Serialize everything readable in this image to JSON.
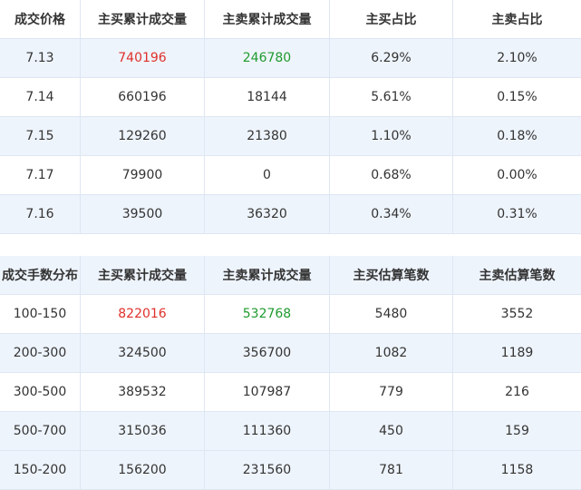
{
  "price_table": {
    "headers": [
      "成交价格",
      "主买累计成交量",
      "主卖累计成交量",
      "主买占比",
      "主卖占比"
    ],
    "rows": [
      [
        "7.13",
        "740196",
        "246780",
        "6.29%",
        "2.10%"
      ],
      [
        "7.14",
        "660196",
        "18144",
        "5.61%",
        "0.15%"
      ],
      [
        "7.15",
        "129260",
        "21380",
        "1.10%",
        "0.18%"
      ],
      [
        "7.17",
        "79900",
        "0",
        "0.68%",
        "0.00%"
      ],
      [
        "7.16",
        "39500",
        "36320",
        "0.34%",
        "0.31%"
      ]
    ]
  },
  "lot_table": {
    "headers": [
      "成交手数分布",
      "主买累计成交量",
      "主卖累计成交量",
      "主买估算笔数",
      "主卖估算笔数"
    ],
    "rows": [
      [
        "100-150",
        "822016",
        "532768",
        "5480",
        "3552"
      ],
      [
        "200-300",
        "324500",
        "356700",
        "1082",
        "1189"
      ],
      [
        "300-500",
        "389532",
        "107987",
        "779",
        "216"
      ],
      [
        "500-700",
        "315036",
        "111360",
        "450",
        "159"
      ],
      [
        "150-200",
        "156200",
        "231560",
        "781",
        "1158"
      ]
    ]
  },
  "colors": {
    "buy_highlight": "#e0302b",
    "sell_highlight": "#1f9b2e",
    "stripe": "#eef4fc"
  }
}
